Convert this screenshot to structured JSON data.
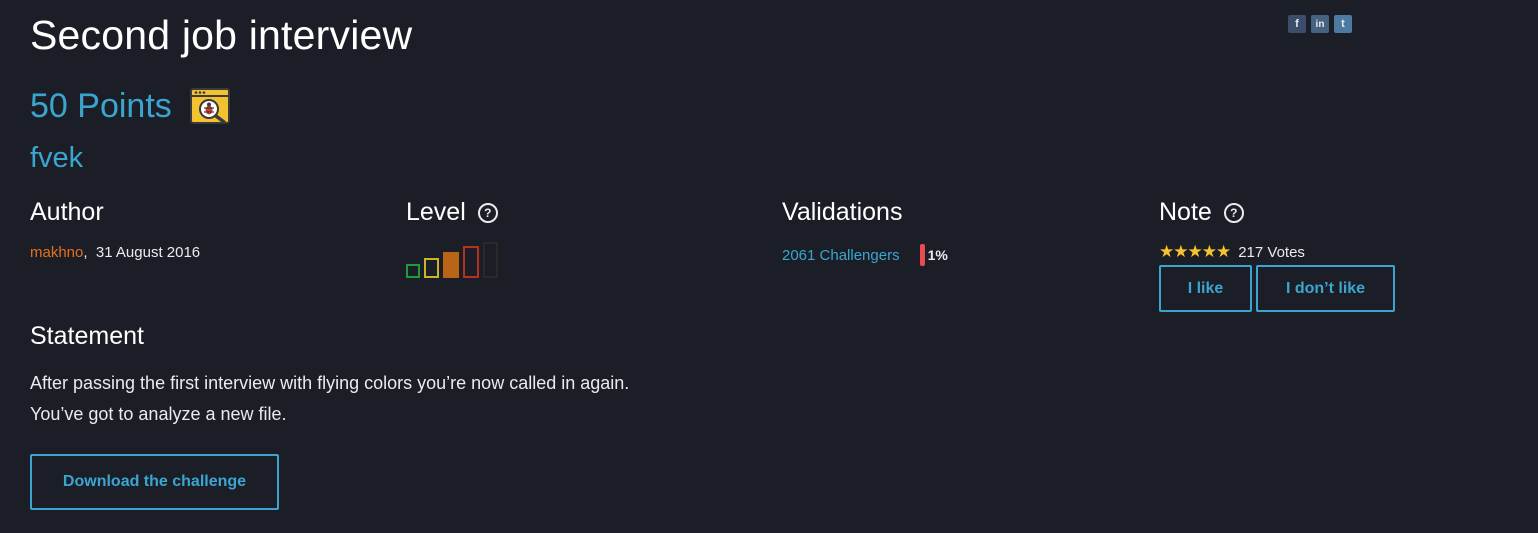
{
  "challenge": {
    "title": "Second job interview",
    "points": "50 Points",
    "category_icon": "bug-in-window-icon",
    "category": "fvek"
  },
  "social": {
    "facebook": "f",
    "linkedin": "in",
    "twitter": "t"
  },
  "author": {
    "heading": "Author",
    "name": "makhno",
    "separator": ",",
    "date": "31 August 2016"
  },
  "level": {
    "heading": "Level",
    "help": "?",
    "current": 3,
    "max": 5,
    "colors": [
      "#1f9a3a",
      "#c8b526",
      "#b96416",
      "#b3321e",
      "#2a2a2a"
    ]
  },
  "validations": {
    "heading": "Validations",
    "challengers": "2061 Challengers",
    "percent": "1%",
    "bar_color": "#e84b50"
  },
  "note": {
    "heading": "Note",
    "help": "?",
    "stars": "★★★★★",
    "votes": "217 Votes",
    "like_label": "I like",
    "dislike_label": "I don’t like"
  },
  "statement": {
    "heading": "Statement",
    "line1": "After passing the first interview with flying colors you’re now called in again.",
    "line2": "You’ve got to analyze a new file."
  },
  "download_label": "Download the challenge"
}
